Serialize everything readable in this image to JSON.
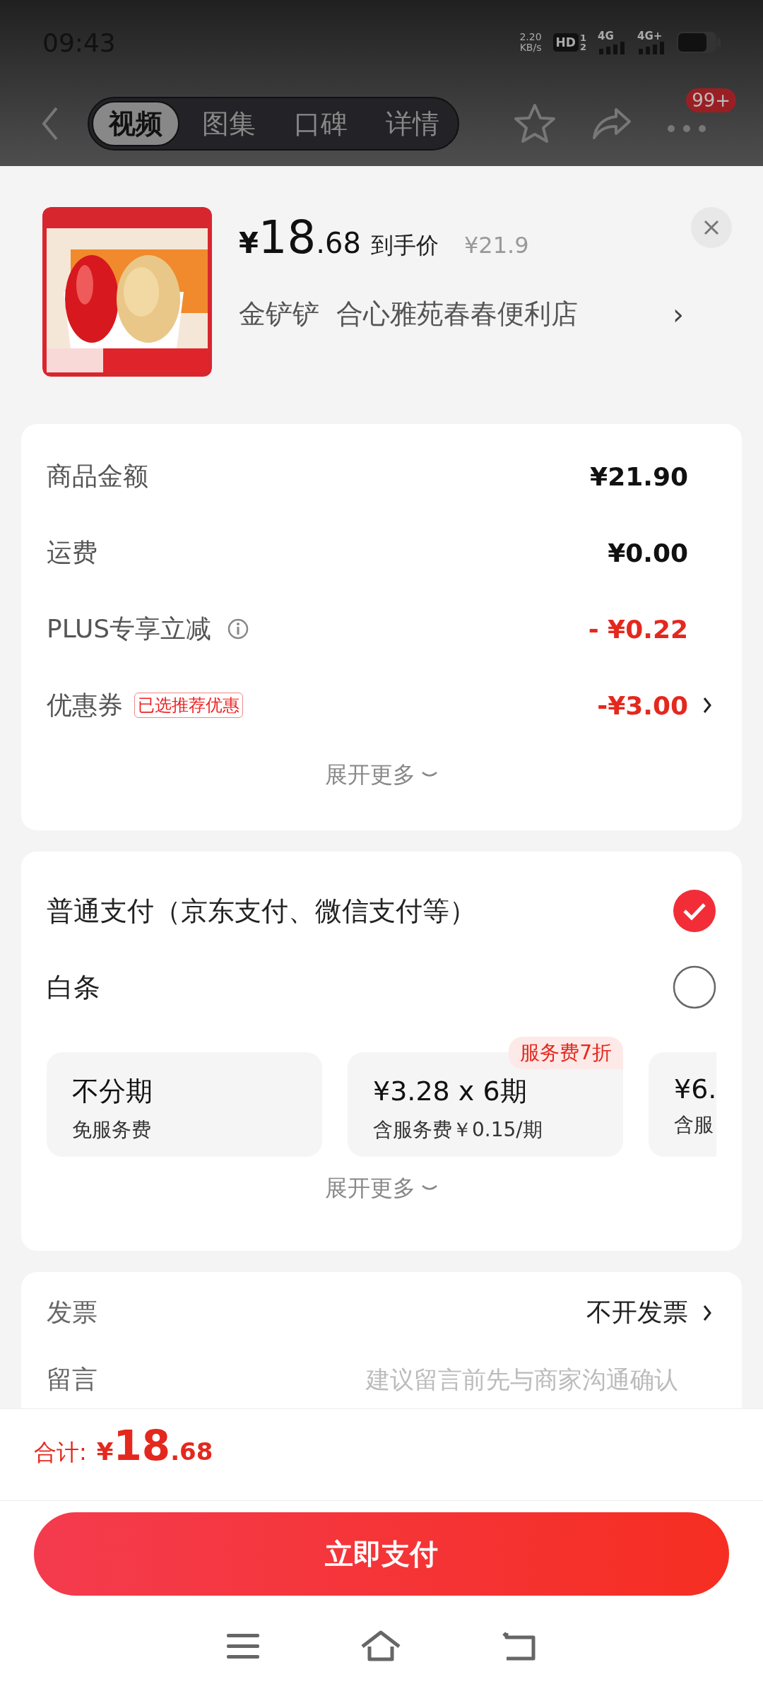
{
  "status_bar": {
    "time": "09:43",
    "speed": "2.20",
    "speed_unit": "KB/s",
    "hd": "HD",
    "sim_1": "1",
    "sim_2": "2",
    "network_1": "4G",
    "network_2": "4G+"
  },
  "nav": {
    "tabs": [
      {
        "label": "视频",
        "selected": true
      },
      {
        "label": "图集",
        "selected": false
      },
      {
        "label": "口碑",
        "selected": false
      },
      {
        "label": "详情",
        "selected": false
      }
    ],
    "badge": "99+"
  },
  "product": {
    "price_symbol": "¥",
    "price_int": "18",
    "price_dec": ".68",
    "price_label": "到手价",
    "original_price": "¥21.9",
    "store": "金铲铲  合心雅苑春春便利店",
    "chevron": "›"
  },
  "summary": {
    "rows": [
      {
        "label": "商品金额",
        "value": "¥21.90",
        "kind": "charge",
        "info": false,
        "chevron": false
      },
      {
        "label": "运费",
        "value": "¥0.00",
        "kind": "charge",
        "info": false,
        "chevron": false
      },
      {
        "label": "PLUS专享立减",
        "value": "- ¥0.22",
        "kind": "discount",
        "info": true,
        "chevron": false
      },
      {
        "label": "优惠券",
        "tag": "已选推荐优惠",
        "value": "-¥3.00",
        "kind": "discount",
        "info": false,
        "chevron": true
      }
    ],
    "expand": "展开更多"
  },
  "payment": {
    "options": [
      {
        "label": "普通支付（京东支付、微信支付等）",
        "selected": true
      },
      {
        "label": "白条",
        "selected": false
      }
    ],
    "plans": [
      {
        "title": "不分期",
        "subtitle": "免服务费"
      },
      {
        "title": "¥3.28 x 6期",
        "subtitle": "含服务费￥0.15/期",
        "badge": "服务费7折"
      },
      {
        "title": "¥6.",
        "subtitle": "含服"
      }
    ],
    "expand": "展开更多"
  },
  "extras": {
    "rows": [
      {
        "label": "发票",
        "value": "不开发票",
        "chevron": true
      },
      {
        "label": "留言",
        "placeholder": "建议留言前先与商家沟通确认",
        "chevron": false
      }
    ]
  },
  "footer": {
    "total_label": "合计:",
    "total_symbol": "¥",
    "total_int": "18",
    "total_dec": ".68",
    "pay_button": "立即支付"
  }
}
